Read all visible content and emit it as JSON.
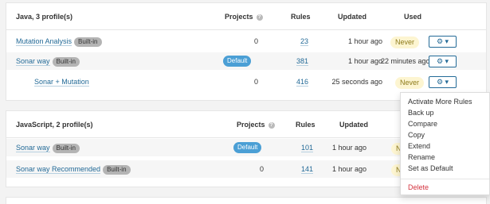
{
  "java": {
    "title": "Java, 3 profile(s)",
    "headers": {
      "projects": "Projects",
      "rules": "Rules",
      "updated": "Updated",
      "used": "Used"
    },
    "rows": [
      {
        "name": "Mutation Analysis",
        "badge": "Built-in",
        "projects": "0",
        "rules": "23",
        "updated": "1 hour ago",
        "used": "Never"
      },
      {
        "name": "Sonar way",
        "badge": "Built-in",
        "projects_badge": "Default",
        "rules": "381",
        "updated": "1 hour ago",
        "used": "22 minutes ago"
      },
      {
        "name": "Sonar + Mutation",
        "projects": "0",
        "rules": "416",
        "updated": "25 seconds ago",
        "used": "Never"
      }
    ]
  },
  "javascript": {
    "title": "JavaScript, 2 profile(s)",
    "headers": {
      "projects": "Projects",
      "rules": "Rules",
      "updated": "Updated"
    },
    "rows": [
      {
        "name": "Sonar way",
        "badge": "Built-in",
        "projects_badge": "Default",
        "rules": "101",
        "updated": "1 hour ago",
        "used_partial": "N"
      },
      {
        "name": "Sonar way Recommended",
        "badge": "Built-in",
        "projects": "0",
        "rules": "141",
        "updated": "1 hour ago",
        "used_partial": "N"
      }
    ]
  },
  "actions_menu": {
    "items": [
      "Activate More Rules",
      "Back up",
      "Compare",
      "Copy",
      "Extend",
      "Rename",
      "Set as Default"
    ],
    "danger_item": "Delete"
  },
  "icons": {
    "gear": "⚙",
    "caret": "▾",
    "help": "?"
  },
  "colors": {
    "link": "#236a97",
    "default_badge": "#4b9fd5",
    "never_badge": "#fdf5d1",
    "danger": "#d4333f"
  }
}
